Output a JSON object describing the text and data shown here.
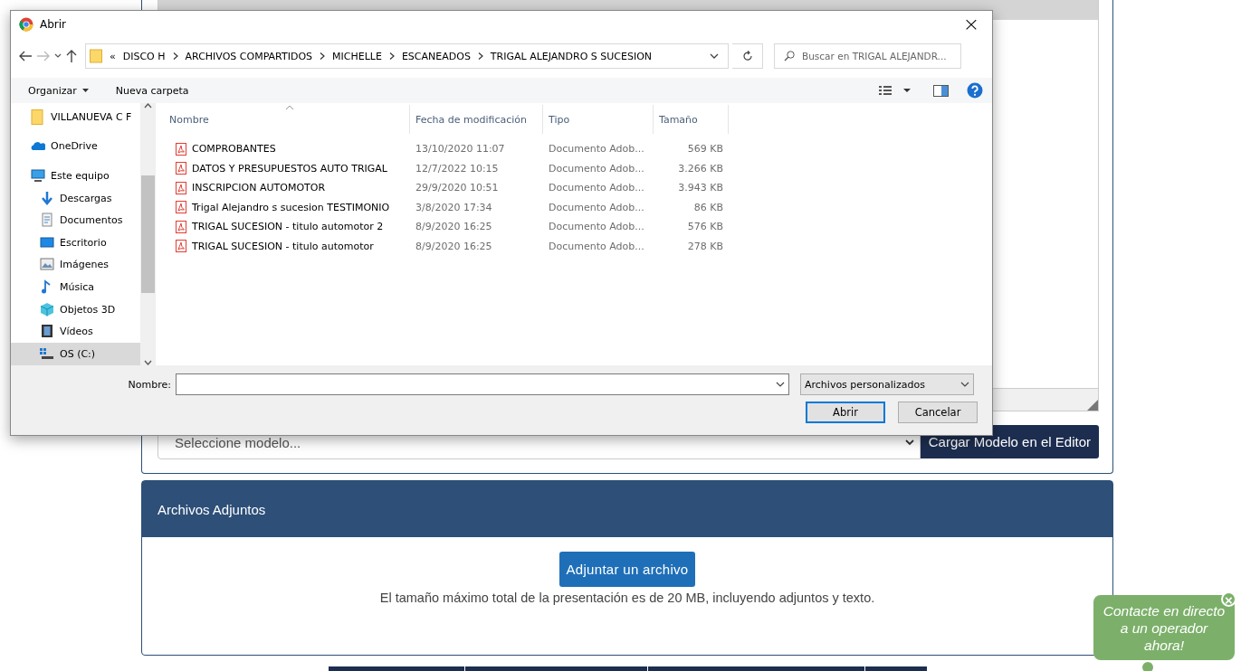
{
  "page": {
    "model_select": {
      "placeholder": "Seleccione modelo..."
    },
    "load_button": "Cargar Modelo en el Editor",
    "attachments": {
      "title": "Archivos Adjuntos",
      "button": "Adjuntar un archivo",
      "note": "El tamaño máximo total de la presentación es de 20 MB, incluyendo adjuntos y texto."
    },
    "chat_bubble": {
      "text": "Contacte en directo a un operador ahora!",
      "close": "×"
    }
  },
  "dialog": {
    "title": "Abrir",
    "close": "×",
    "path_overflow": "«",
    "breadcrumb": [
      "DISCO H",
      "ARCHIVOS COMPARTIDOS",
      "MICHELLE",
      "ESCANEADOS",
      "TRIGAL ALEJANDRO S SUCESION"
    ],
    "search": {
      "placeholder": "Buscar en TRIGAL ALEJANDR..."
    },
    "toolbar": [
      {
        "label": "Organizar",
        "dropdown": true
      },
      {
        "label": "Nueva carpeta",
        "dropdown": false
      }
    ],
    "nav": [
      {
        "label": "VILLANUEVA C F",
        "kind": "folder",
        "selected": false
      },
      {
        "label": "OneDrive",
        "kind": "cloud",
        "selected": false
      },
      {
        "label": "Este equipo",
        "kind": "computer",
        "selected": false,
        "children": [
          {
            "label": "Descargas",
            "kind": "download",
            "selected": false
          },
          {
            "label": "Documentos",
            "kind": "document",
            "selected": false
          },
          {
            "label": "Escritorio",
            "kind": "desktop",
            "selected": false
          },
          {
            "label": "Imágenes",
            "kind": "image",
            "selected": false
          },
          {
            "label": "Música",
            "kind": "music",
            "selected": false
          },
          {
            "label": "Objetos 3D",
            "kind": "cube",
            "selected": false
          },
          {
            "label": "Vídeos",
            "kind": "video",
            "selected": false
          },
          {
            "label": "OS (C:)",
            "kind": "drive",
            "selected": true
          }
        ]
      }
    ],
    "columns": [
      "Nombre",
      "Fecha de modificación",
      "Tipo",
      "Tamaño"
    ],
    "files": [
      {
        "name": "COMPROBANTES",
        "date": "13/10/2020 11:07",
        "type": "Documento Adob...",
        "size": "569 KB"
      },
      {
        "name": "DATOS Y PRESUPUESTOS AUTO TRIGAL",
        "date": "12/7/2022 10:15",
        "type": "Documento Adob...",
        "size": "3.266 KB"
      },
      {
        "name": "INSCRIPCION AUTOMOTOR",
        "date": "29/9/2020 10:51",
        "type": "Documento Adob...",
        "size": "3.943 KB"
      },
      {
        "name": "Trigal Alejandro s sucesion TESTIMONIO",
        "date": "3/8/2020 17:34",
        "type": "Documento Adob...",
        "size": "86 KB"
      },
      {
        "name": "TRIGAL SUCESION - titulo automotor 2",
        "date": "8/9/2020 16:25",
        "type": "Documento Adob...",
        "size": "576 KB"
      },
      {
        "name": "TRIGAL SUCESION - titulo automotor",
        "date": "8/9/2020 16:25",
        "type": "Documento Adob...",
        "size": "278 KB"
      }
    ],
    "filename_label": "Nombre:",
    "filetype": "Archivos personalizados",
    "buttons": [
      {
        "label": "Abrir",
        "default": true
      },
      {
        "label": "Cancelar",
        "default": false
      }
    ]
  }
}
